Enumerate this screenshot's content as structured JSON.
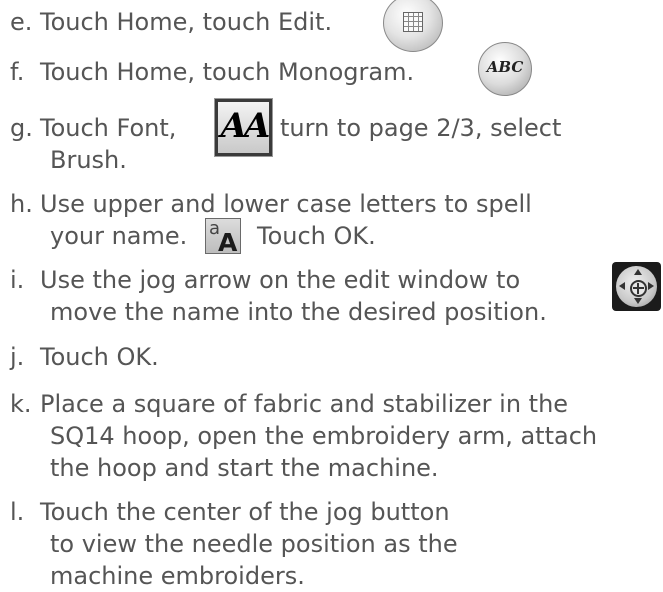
{
  "steps": [
    {
      "letter": "e.",
      "lines": [
        "Touch Home, touch Edit."
      ],
      "icon": "edit-grid-icon"
    },
    {
      "letter": "f.",
      "lines": [
        "Touch Home, touch Monogram."
      ],
      "icon": "monogram-abc-icon"
    },
    {
      "letter": "g.",
      "lines": [
        "Touch Font,",
        "turn to page 2/3, select",
        "Brush."
      ],
      "icon": "font-aa-icon"
    },
    {
      "letter": "h.",
      "lines": [
        "Use upper and lower case letters to spell",
        "your name.",
        "Touch OK."
      ],
      "icon": "upper-lower-case-icon"
    },
    {
      "letter": "i.",
      "lines": [
        "Use the jog arrow on the edit window to",
        "move the name into the desired position."
      ],
      "icon": "jog-arrow-icon"
    },
    {
      "letter": "j.",
      "lines": [
        "Touch OK."
      ]
    },
    {
      "letter": "k.",
      "lines": [
        "Place a square of fabric and stabilizer in the",
        "SQ14 hoop, open the embroidery arm, attach",
        "the hoop and start the machine."
      ]
    },
    {
      "letter": "l.",
      "lines": [
        "Touch the center of the jog button",
        "to view the needle position as the",
        "machine embroiders."
      ]
    }
  ],
  "icon_labels": {
    "monogram": "ABC",
    "font": "AA",
    "case_small": "a",
    "case_big": "A"
  },
  "colors": {
    "text": "#555555",
    "background": "#ffffff"
  }
}
